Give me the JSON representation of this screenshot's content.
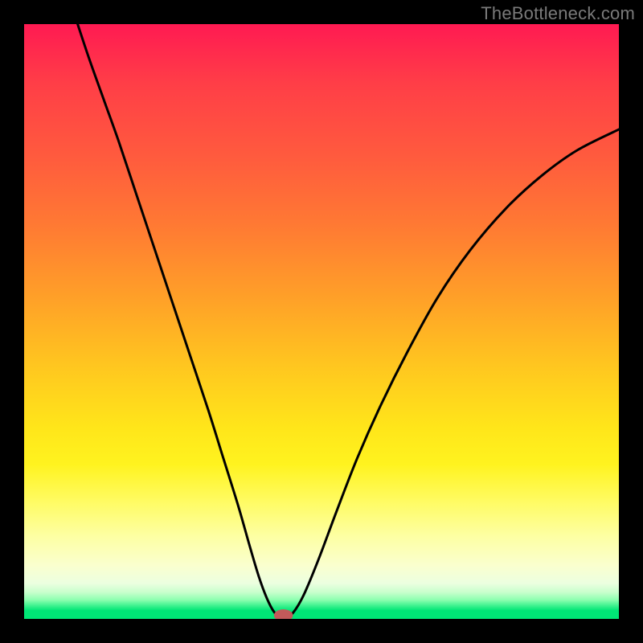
{
  "watermark": "TheBottleneck.com",
  "chart_data": {
    "type": "line",
    "title": "",
    "xlabel": "",
    "ylabel": "",
    "xlim": [
      0,
      1
    ],
    "ylim": [
      0,
      1
    ],
    "background_gradient_stops": [
      {
        "pos": 0.0,
        "color": "#ff1a52"
      },
      {
        "pos": 0.1,
        "color": "#ff3e47"
      },
      {
        "pos": 0.22,
        "color": "#ff5a3e"
      },
      {
        "pos": 0.34,
        "color": "#ff7a33"
      },
      {
        "pos": 0.46,
        "color": "#ffa028"
      },
      {
        "pos": 0.58,
        "color": "#ffc81f"
      },
      {
        "pos": 0.68,
        "color": "#ffe61a"
      },
      {
        "pos": 0.74,
        "color": "#fff31f"
      },
      {
        "pos": 0.8,
        "color": "#fffb60"
      },
      {
        "pos": 0.86,
        "color": "#fdffa2"
      },
      {
        "pos": 0.91,
        "color": "#faffce"
      },
      {
        "pos": 0.94,
        "color": "#ecffe0"
      },
      {
        "pos": 0.955,
        "color": "#c9ffcd"
      },
      {
        "pos": 0.968,
        "color": "#8dffb0"
      },
      {
        "pos": 0.978,
        "color": "#3cf28e"
      },
      {
        "pos": 0.986,
        "color": "#00e676"
      },
      {
        "pos": 1.0,
        "color": "#00e676"
      }
    ],
    "series": [
      {
        "name": "bottleneck-curve",
        "color": "#000000",
        "stroke_width": 3,
        "points": [
          {
            "x": 0.09,
            "y": 1.0
          },
          {
            "x": 0.11,
            "y": 0.94
          },
          {
            "x": 0.135,
            "y": 0.87
          },
          {
            "x": 0.16,
            "y": 0.8
          },
          {
            "x": 0.19,
            "y": 0.71
          },
          {
            "x": 0.22,
            "y": 0.62
          },
          {
            "x": 0.25,
            "y": 0.53
          },
          {
            "x": 0.28,
            "y": 0.44
          },
          {
            "x": 0.31,
            "y": 0.35
          },
          {
            "x": 0.335,
            "y": 0.27
          },
          {
            "x": 0.36,
            "y": 0.19
          },
          {
            "x": 0.38,
            "y": 0.12
          },
          {
            "x": 0.395,
            "y": 0.07
          },
          {
            "x": 0.408,
            "y": 0.035
          },
          {
            "x": 0.42,
            "y": 0.012
          },
          {
            "x": 0.43,
            "y": 0.004
          },
          {
            "x": 0.44,
            "y": 0.003
          },
          {
            "x": 0.452,
            "y": 0.01
          },
          {
            "x": 0.47,
            "y": 0.04
          },
          {
            "x": 0.495,
            "y": 0.1
          },
          {
            "x": 0.525,
            "y": 0.18
          },
          {
            "x": 0.56,
            "y": 0.27
          },
          {
            "x": 0.6,
            "y": 0.36
          },
          {
            "x": 0.645,
            "y": 0.45
          },
          {
            "x": 0.695,
            "y": 0.54
          },
          {
            "x": 0.75,
            "y": 0.62
          },
          {
            "x": 0.81,
            "y": 0.69
          },
          {
            "x": 0.87,
            "y": 0.745
          },
          {
            "x": 0.93,
            "y": 0.788
          },
          {
            "x": 1.0,
            "y": 0.823
          }
        ]
      }
    ],
    "marker": {
      "name": "minimum-marker",
      "x": 0.436,
      "y": 0.006,
      "rx": 0.016,
      "ry": 0.01,
      "color": "#c25a5a"
    }
  }
}
